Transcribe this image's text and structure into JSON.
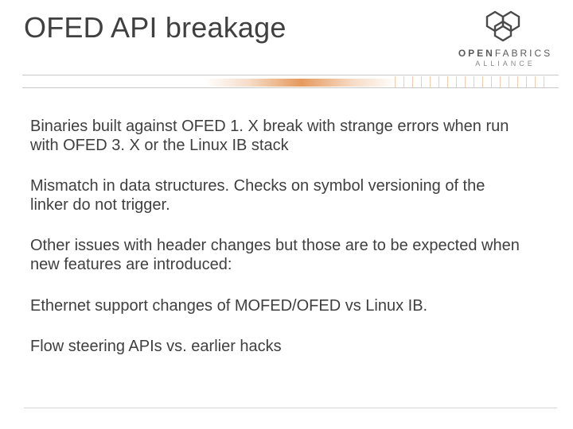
{
  "title": "OFED API breakage",
  "logo": {
    "brand_bold": "OPEN",
    "brand_rest": "FABRICS",
    "sub": "ALLIANCE"
  },
  "paragraphs": [
    "Binaries built against OFED 1. X break with strange errors when run with OFED 3. X or the Linux IB stack",
    "Mismatch in data structures. Checks on symbol versioning of the linker do not trigger.",
    "Other issues with header changes but those are to be expected when new features are introduced:",
    "Ethernet support changes of MOFED/OFED vs Linux IB.",
    "Flow steering APIs vs. earlier hacks"
  ]
}
